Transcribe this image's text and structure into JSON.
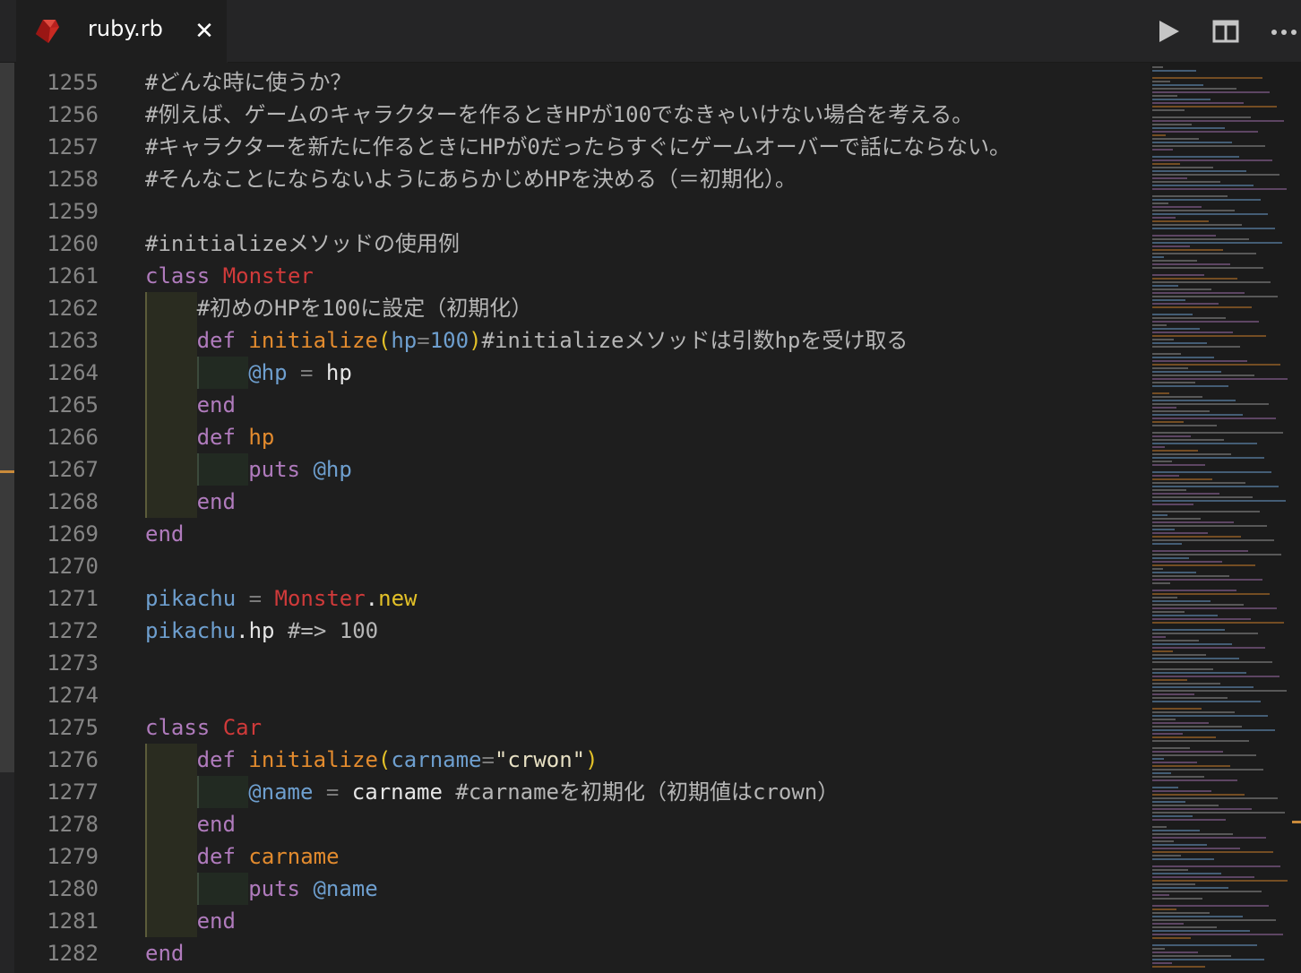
{
  "tab": {
    "title": "ruby.rb",
    "close_symbol": "✕",
    "icon": "ruby-gem-icon"
  },
  "actions": [
    {
      "name": "run-icon"
    },
    {
      "name": "split-editor-icon"
    },
    {
      "name": "more-actions-icon"
    }
  ],
  "lines": [
    {
      "n": "1255",
      "indent": 0,
      "tokens": [
        {
          "t": "#どんな時に使うか？",
          "c": "cm"
        }
      ]
    },
    {
      "n": "1256",
      "indent": 0,
      "tokens": [
        {
          "t": "#例えば、ゲームのキャラクターを作るときHPが100でなきゃいけない場合を考える。",
          "c": "cm"
        }
      ]
    },
    {
      "n": "1257",
      "indent": 0,
      "tokens": [
        {
          "t": "#キャラクターを新たに作るときにHPが0だったらすぐにゲームオーバーで話にならない。",
          "c": "cm"
        }
      ]
    },
    {
      "n": "1258",
      "indent": 0,
      "tokens": [
        {
          "t": "#そんなことにならないようにあらかじめHPを決める（＝初期化）。",
          "c": "cm"
        }
      ]
    },
    {
      "n": "1259",
      "indent": 0,
      "tokens": []
    },
    {
      "n": "1260",
      "indent": 0,
      "tokens": [
        {
          "t": "#initializeメソッドの使用例",
          "c": "cm"
        }
      ]
    },
    {
      "n": "1261",
      "indent": 0,
      "tokens": [
        {
          "t": "class",
          "c": "kw"
        },
        {
          "t": " ",
          "c": "pl"
        },
        {
          "t": "Monster",
          "c": "cls"
        }
      ]
    },
    {
      "n": "1262",
      "indent": 1,
      "tokens": [
        {
          "t": "#初めのHPを100に設定（初期化）",
          "c": "cm"
        }
      ]
    },
    {
      "n": "1263",
      "indent": 1,
      "tokens": [
        {
          "t": "def",
          "c": "kw"
        },
        {
          "t": " ",
          "c": "pl"
        },
        {
          "t": "initialize",
          "c": "fn"
        },
        {
          "t": "(",
          "c": "par"
        },
        {
          "t": "hp",
          "c": "vr"
        },
        {
          "t": "=",
          "c": "op"
        },
        {
          "t": "100",
          "c": "num"
        },
        {
          "t": ")",
          "c": "par"
        },
        {
          "t": "#initializeメソッドは引数hpを受け取る",
          "c": "cm"
        }
      ]
    },
    {
      "n": "1264",
      "indent": 2,
      "tokens": [
        {
          "t": "@hp",
          "c": "vr"
        },
        {
          "t": " = ",
          "c": "op"
        },
        {
          "t": "hp",
          "c": "pl"
        }
      ]
    },
    {
      "n": "1265",
      "indent": 1,
      "tokens": [
        {
          "t": "end",
          "c": "kw"
        }
      ]
    },
    {
      "n": "1266",
      "indent": 1,
      "tokens": [
        {
          "t": "def",
          "c": "kw"
        },
        {
          "t": " ",
          "c": "pl"
        },
        {
          "t": "hp",
          "c": "fn"
        }
      ]
    },
    {
      "n": "1267",
      "indent": 2,
      "tokens": [
        {
          "t": "puts",
          "c": "kw"
        },
        {
          "t": " ",
          "c": "pl"
        },
        {
          "t": "@hp",
          "c": "vr"
        }
      ]
    },
    {
      "n": "1268",
      "indent": 1,
      "tokens": [
        {
          "t": "end",
          "c": "kw"
        }
      ]
    },
    {
      "n": "1269",
      "indent": 0,
      "tokens": [
        {
          "t": "end",
          "c": "kw"
        }
      ]
    },
    {
      "n": "1270",
      "indent": 0,
      "tokens": []
    },
    {
      "n": "1271",
      "indent": 0,
      "tokens": [
        {
          "t": "pikachu",
          "c": "vr"
        },
        {
          "t": " = ",
          "c": "op"
        },
        {
          "t": "Monster",
          "c": "cls"
        },
        {
          "t": ".",
          "c": "pl"
        },
        {
          "t": "new",
          "c": "nw"
        }
      ]
    },
    {
      "n": "1272",
      "indent": 0,
      "tokens": [
        {
          "t": "pikachu",
          "c": "vr"
        },
        {
          "t": ".hp ",
          "c": "pl"
        },
        {
          "t": "#=> 100",
          "c": "cm"
        }
      ]
    },
    {
      "n": "1273",
      "indent": 0,
      "tokens": []
    },
    {
      "n": "1274",
      "indent": 0,
      "tokens": []
    },
    {
      "n": "1275",
      "indent": 0,
      "tokens": [
        {
          "t": "class",
          "c": "kw"
        },
        {
          "t": " ",
          "c": "pl"
        },
        {
          "t": "Car",
          "c": "cls"
        }
      ]
    },
    {
      "n": "1276",
      "indent": 1,
      "tokens": [
        {
          "t": "def",
          "c": "kw"
        },
        {
          "t": " ",
          "c": "pl"
        },
        {
          "t": "initialize",
          "c": "fn"
        },
        {
          "t": "(",
          "c": "par"
        },
        {
          "t": "carname",
          "c": "vr"
        },
        {
          "t": "=",
          "c": "op"
        },
        {
          "t": "\"crwon\"",
          "c": "str"
        },
        {
          "t": ")",
          "c": "par"
        }
      ]
    },
    {
      "n": "1277",
      "indent": 2,
      "tokens": [
        {
          "t": "@name",
          "c": "vr"
        },
        {
          "t": " = ",
          "c": "op"
        },
        {
          "t": "carname ",
          "c": "pl"
        },
        {
          "t": "#carnameを初期化（初期値はcrown）",
          "c": "cm"
        }
      ]
    },
    {
      "n": "1278",
      "indent": 1,
      "tokens": [
        {
          "t": "end",
          "c": "kw"
        }
      ]
    },
    {
      "n": "1279",
      "indent": 1,
      "tokens": [
        {
          "t": "def",
          "c": "kw"
        },
        {
          "t": " ",
          "c": "pl"
        },
        {
          "t": "carname",
          "c": "fn"
        }
      ]
    },
    {
      "n": "1280",
      "indent": 2,
      "tokens": [
        {
          "t": "puts",
          "c": "kw"
        },
        {
          "t": " ",
          "c": "pl"
        },
        {
          "t": "@name",
          "c": "vr"
        }
      ]
    },
    {
      "n": "1281",
      "indent": 1,
      "tokens": [
        {
          "t": "end",
          "c": "kw"
        }
      ]
    },
    {
      "n": "1282",
      "indent": 0,
      "tokens": [
        {
          "t": "end",
          "c": "kw"
        }
      ]
    }
  ]
}
